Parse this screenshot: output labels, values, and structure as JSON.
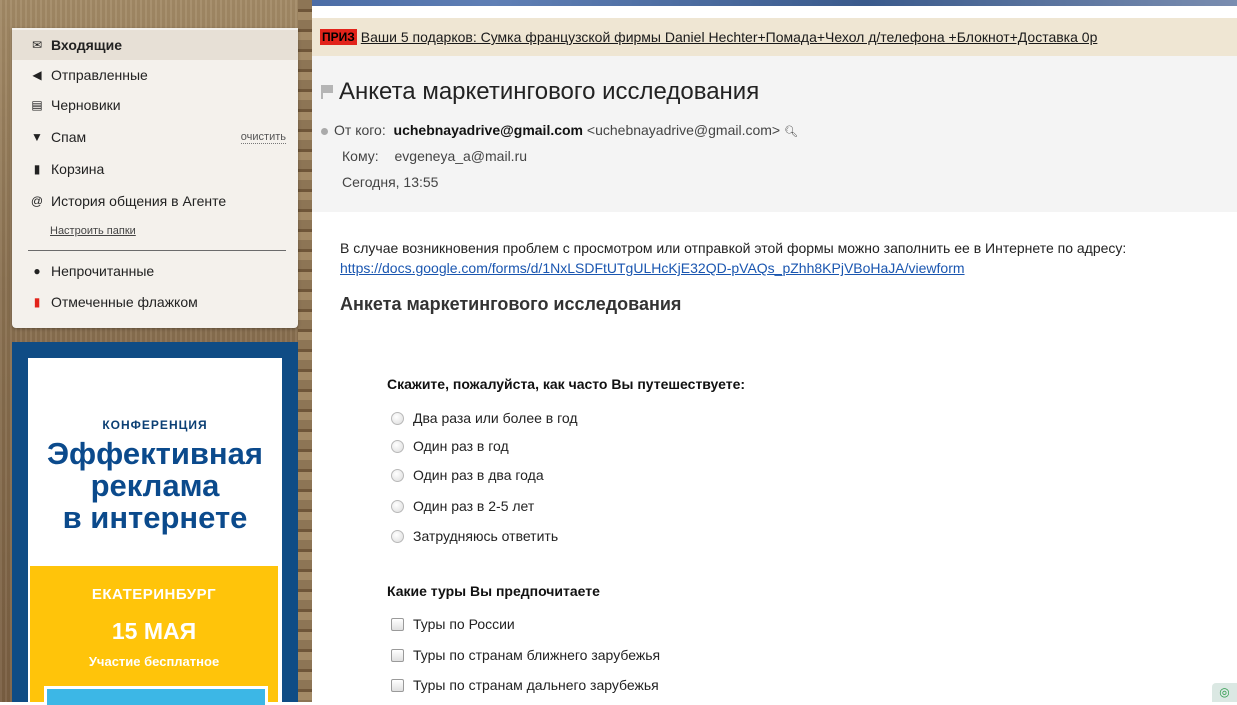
{
  "sidebar": {
    "folders": [
      {
        "icon": "envelope-icon",
        "glyph": "✉",
        "label": "Входящие",
        "active": true
      },
      {
        "icon": "sent-arrow-icon",
        "glyph": "◀",
        "label": "Отправленные"
      },
      {
        "icon": "draft-icon",
        "glyph": "▤",
        "label": "Черновики"
      },
      {
        "icon": "thumbs-down-icon",
        "glyph": "▼",
        "label": "Спам",
        "action": "очистить"
      },
      {
        "icon": "trash-icon",
        "glyph": "▮",
        "label": "Корзина"
      },
      {
        "icon": "at-icon",
        "glyph": "@",
        "label": "История общения в Агенте"
      }
    ],
    "setup_link": "Настроить папки",
    "filters": [
      {
        "icon": "dot-icon",
        "glyph": "●",
        "label": "Непрочитанные"
      },
      {
        "icon": "red-flag-icon",
        "glyph": "▮",
        "label": "Отмеченные флажком",
        "color": "#e2231a"
      }
    ]
  },
  "ad": {
    "conference_label": "КОНФЕРЕНЦИЯ",
    "title_line1": "Эффективная",
    "title_line2": "реклама",
    "title_line3": "в интернете",
    "city": "ЕКАТЕРИНБУРГ",
    "date": "15 МАЯ",
    "free": "Участие бесплатное",
    "brand_color": "#0f4c85",
    "accent_color": "#ffc40a"
  },
  "promo": {
    "badge": "ПРИЗ",
    "text": "Ваши 5 подарков: Сумка французской фирмы Daniel Hechter+Помада+Чехол д/телефона +Блокнот+Доставка 0р"
  },
  "message": {
    "subject": "Анкета маркетингового исследования",
    "from_label": "От кого:",
    "from_name": "uchebnayadrive@gmail.com",
    "from_addr": "<uchebnayadrive@gmail.com>",
    "to_label": "Кому:",
    "to_addr": "evgeneya_a@mail.ru",
    "date": "Сегодня, 13:55"
  },
  "body": {
    "intro": "В случае возникновения проблем с просмотром или отправкой этой формы можно заполнить ее в Интернете по адресу:",
    "link": "https://docs.google.com/forms/d/1NxLSDFtUTgULHcKjE32QD-pVAQs_pZhh8KPjVBoHaJA/viewform",
    "form_title": "Анкета маркетингового исследования",
    "q1": {
      "label": "Скажите, пожалуйста, как часто Вы путешествуете:",
      "options": [
        "Два раза или более в год",
        "Один раз в год",
        "Один раз в два года",
        "Один раз в 2-5 лет",
        "Затрудняюсь ответить"
      ]
    },
    "q2": {
      "label": "Какие туры Вы предпочитаете",
      "options": [
        "Туры по России",
        "Туры по странам ближнего зарубежья",
        "Туры по странам дальнего зарубежья"
      ]
    }
  }
}
